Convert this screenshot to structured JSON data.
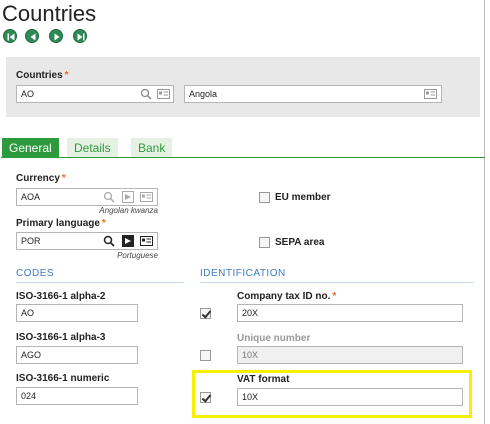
{
  "page": {
    "title": "Countries"
  },
  "nav": {
    "first": "first-record-icon",
    "prev": "previous-record-icon",
    "next": "next-record-icon",
    "last": "last-record-icon"
  },
  "key": {
    "label": "Countries",
    "code": "AO",
    "name": "Angola"
  },
  "tabs": [
    {
      "label": "General"
    },
    {
      "label": "Details"
    },
    {
      "label": "Bank"
    }
  ],
  "general": {
    "currency": {
      "label": "Currency",
      "value": "AOA",
      "description": "Angolan kwanza"
    },
    "primary_language": {
      "label": "Primary language",
      "value": "POR",
      "description": "Portuguese"
    },
    "eu_member": {
      "label": "EU member",
      "checked": false
    },
    "sepa_area": {
      "label": "SEPA area",
      "checked": false
    }
  },
  "codes": {
    "title": "CODES",
    "alpha2": {
      "label": "ISO-3166-1 alpha-2",
      "value": "AO"
    },
    "alpha3": {
      "label": "ISO-3166-1 alpha-3",
      "value": "AGO"
    },
    "numeric": {
      "label": "ISO-3166-1 numeric",
      "value": "024"
    }
  },
  "identification": {
    "title": "IDENTIFICATION",
    "company_tax_id": {
      "label": "Company tax ID no.",
      "value": "20X",
      "checked": true
    },
    "unique_number": {
      "label": "Unique number",
      "value": "10X",
      "checked": false
    },
    "vat_format": {
      "label": "VAT format",
      "value": "10X",
      "checked": true
    }
  },
  "colors": {
    "accent": "#2e9a3e",
    "required": "#f26522",
    "section": "#3b7bbf",
    "highlight": "#f5f000"
  }
}
